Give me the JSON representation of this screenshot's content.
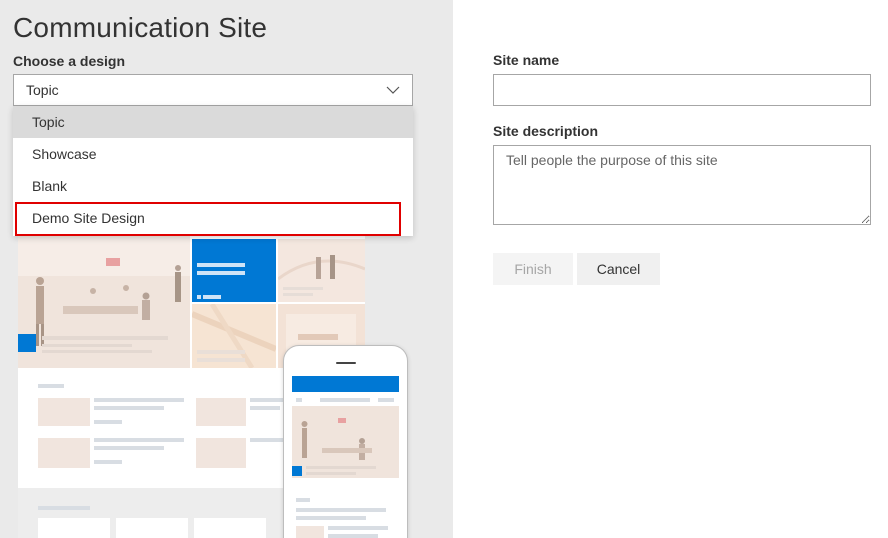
{
  "left": {
    "title": "Communication Site",
    "design_label": "Choose a design",
    "design_selected": "Topic",
    "design_options": [
      "Topic",
      "Showcase",
      "Blank",
      "Demo Site Design"
    ]
  },
  "right": {
    "site_name_label": "Site name",
    "site_name_value": "",
    "site_description_label": "Site description",
    "site_description_placeholder": "Tell people the purpose of this site"
  },
  "buttons": {
    "finish": "Finish",
    "cancel": "Cancel"
  },
  "colors": {
    "accent": "#0078d4",
    "highlight": "#e00000"
  }
}
